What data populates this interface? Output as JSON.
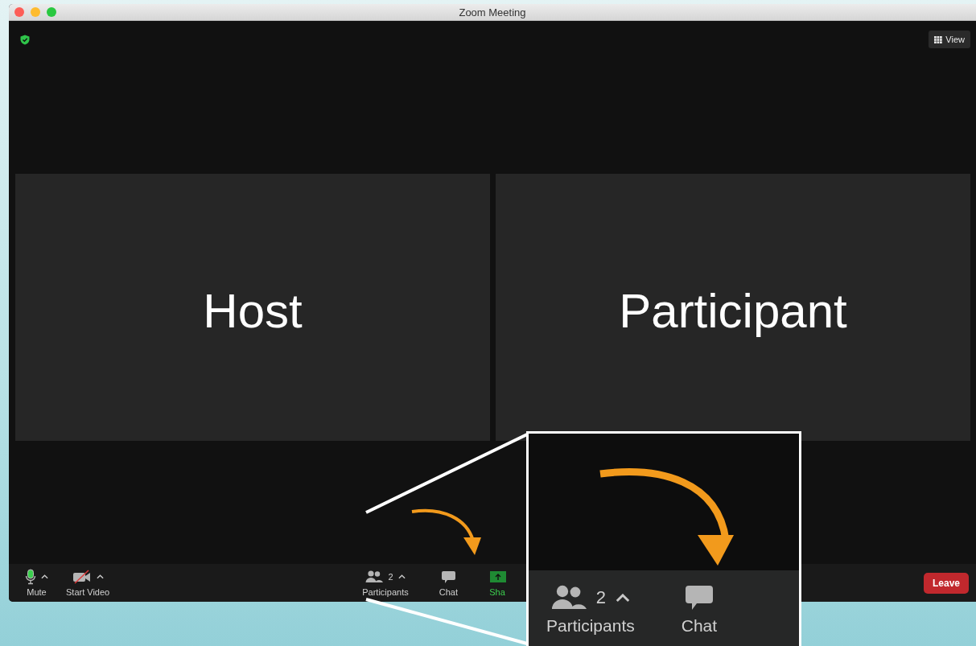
{
  "window": {
    "title": "Zoom Meeting"
  },
  "top_bar": {
    "view_button": "View"
  },
  "tiles": [
    {
      "label": "Host"
    },
    {
      "label": "Participant"
    }
  ],
  "toolbar": {
    "left": [
      {
        "kind": "mic",
        "label": "Mute",
        "muted": false,
        "caret": true
      },
      {
        "kind": "video",
        "label": "Start Video",
        "video_on": false,
        "caret": true
      }
    ],
    "center": [
      {
        "kind": "participants",
        "label": "Participants",
        "badge": "2",
        "caret": true
      },
      {
        "kind": "chat",
        "label": "Chat",
        "caret": false
      },
      {
        "kind": "share",
        "label": "Sha",
        "caret": false
      }
    ],
    "leave": "Leave"
  },
  "callout": {
    "items": [
      {
        "kind": "participants",
        "label": "Participants",
        "badge": "2",
        "caret": true
      },
      {
        "kind": "chat",
        "label": "Chat",
        "caret": false
      }
    ]
  }
}
